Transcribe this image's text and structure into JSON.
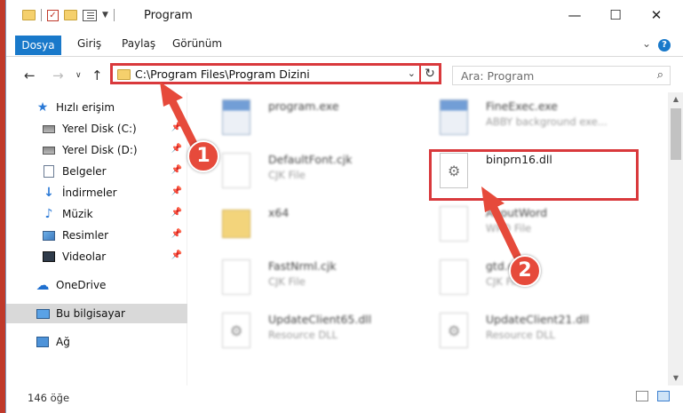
{
  "window": {
    "title": "Program"
  },
  "ribbon": {
    "tabs": [
      "Dosya",
      "Giriş",
      "Paylaş",
      "Görünüm"
    ]
  },
  "nav": {
    "address": "C:\\Program Files\\Program Dizini",
    "search_placeholder": "Ara: Program"
  },
  "sidebar": {
    "items": [
      {
        "label": "Hızlı erişim",
        "icon": "star-icon"
      },
      {
        "label": "Yerel Disk (C:)",
        "icon": "drive-icon",
        "pinned": true
      },
      {
        "label": "Yerel Disk (D:)",
        "icon": "drive-icon",
        "pinned": true
      },
      {
        "label": "Belgeler",
        "icon": "document-icon",
        "pinned": true
      },
      {
        "label": "İndirmeler",
        "icon": "download-icon",
        "pinned": true
      },
      {
        "label": "Müzik",
        "icon": "music-icon",
        "pinned": true
      },
      {
        "label": "Resimler",
        "icon": "picture-icon",
        "pinned": true
      },
      {
        "label": "Videolar",
        "icon": "video-icon",
        "pinned": true
      },
      {
        "label": "OneDrive",
        "icon": "cloud-icon"
      },
      {
        "label": "Bu bilgisayar",
        "icon": "computer-icon",
        "selected": true
      },
      {
        "label": "Ağ",
        "icon": "network-icon"
      }
    ]
  },
  "files": [
    {
      "name": "program.exe",
      "type": ""
    },
    {
      "name": "FineExec.exe",
      "type": "ABBY background exe..."
    },
    {
      "name": "DefaultFont.cjk",
      "type": "CJK File"
    },
    {
      "name": "binprn16.dll",
      "type": "",
      "highlighted": true
    },
    {
      "name": "x64",
      "type": ""
    },
    {
      "name": "AboutWord",
      "type": "WRD File"
    },
    {
      "name": "FastNrml.cjk",
      "type": "CJK File"
    },
    {
      "name": "gtd.cjk",
      "type": "CJK File"
    },
    {
      "name": "UpdateClient65.dll",
      "type": "Resource DLL"
    },
    {
      "name": "UpdateClient21.dll",
      "type": "Resource DLL"
    }
  ],
  "status": {
    "count": "146 öğe"
  },
  "annotations": {
    "badge1": "1",
    "badge2": "2",
    "color": "#e64a3b"
  }
}
